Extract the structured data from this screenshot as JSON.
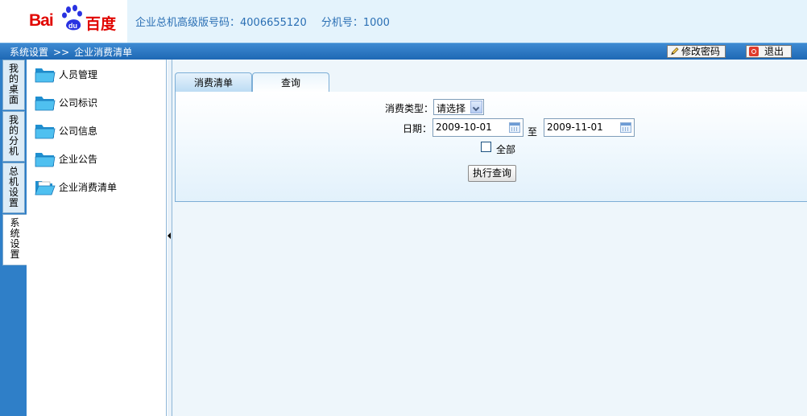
{
  "header": {
    "logo_text_latin": "Bai",
    "logo_text_du": "du",
    "logo_text_cn": "百度",
    "info_label_1": "企业总机高级版号码：4006655120",
    "info_label_2": "分机号：1000"
  },
  "topbar": {
    "breadcrumb_root": "系统设置",
    "breadcrumb_sep": ">>",
    "breadcrumb_current": "企业消费清单",
    "change_password": "修改密码",
    "logout": "退出"
  },
  "vtabs": [
    {
      "label": "我的桌面"
    },
    {
      "label": "我的分机"
    },
    {
      "label": "总机设置"
    },
    {
      "label": "系统设置"
    }
  ],
  "menu": {
    "items": [
      {
        "label": "人员管理"
      },
      {
        "label": "公司标识"
      },
      {
        "label": "公司信息"
      },
      {
        "label": "企业公告"
      },
      {
        "label": "企业消费清单"
      }
    ]
  },
  "content": {
    "tabs": [
      {
        "label": "消费清单"
      },
      {
        "label": "查询"
      }
    ],
    "form": {
      "type_label": "消费类型：",
      "type_value": "请选择",
      "date_label": "日期：",
      "date_from": "2009-10-01",
      "date_to_label": "至",
      "date_to": "2009-11-01",
      "all_label": "全部",
      "all_checked": false,
      "submit_label": "执行查询"
    }
  },
  "colors": {
    "brand_red": "#e10601",
    "brand_blue": "#2932e1",
    "topbar_blue": "#2f7fc8",
    "header_text": "#2a6fb4"
  }
}
